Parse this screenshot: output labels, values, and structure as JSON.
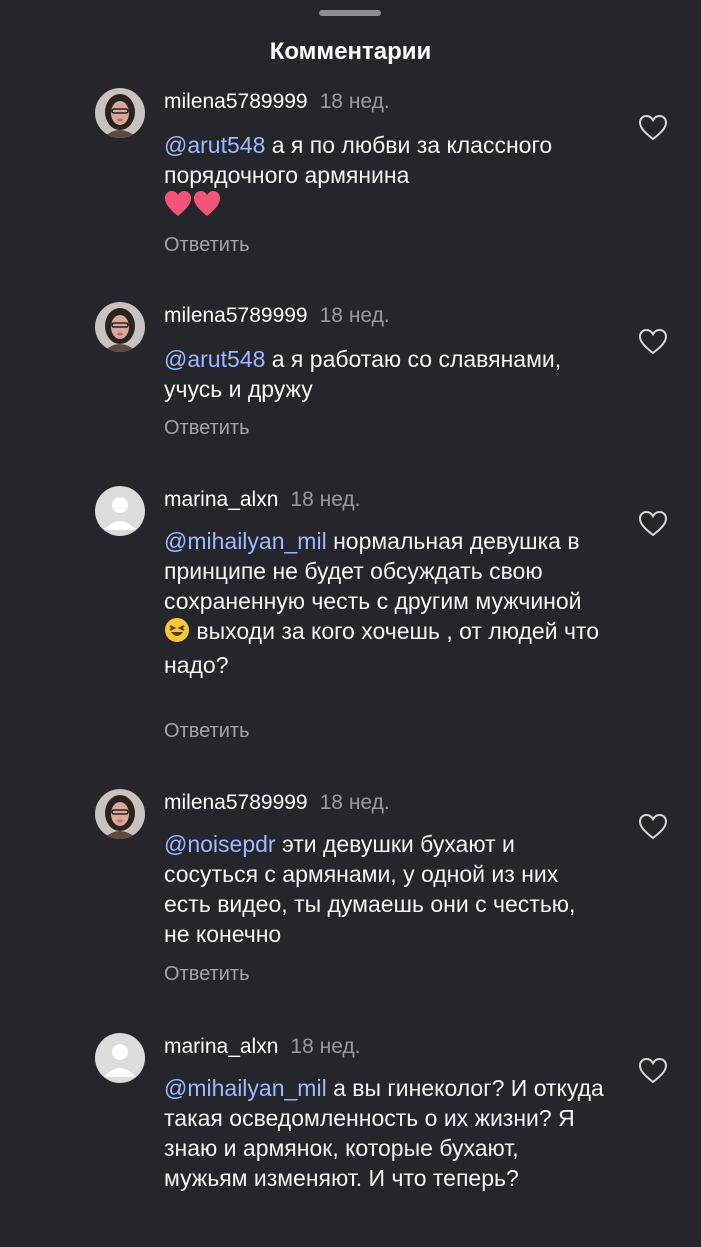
{
  "header": {
    "title": "Комментарии"
  },
  "comments": [
    {
      "username": "milena5789999",
      "time": "18 нед.",
      "mention": "@arut548",
      "text": " а я по любви за классного порядочного армянина",
      "reply_label": "Ответить",
      "avatar": "photo-avatar",
      "emoji": "two-pink-hearts"
    },
    {
      "username": "milena5789999",
      "time": "18 нед.",
      "mention": "@arut548",
      "text": " а я работаю со славянами, учусь и дружу",
      "reply_label": "Ответить",
      "avatar": "photo-avatar"
    },
    {
      "username": "marina_alxn",
      "time": "18 нед.",
      "mention": "@mihailyan_mil",
      "text": " нормальная девушка в принципе не будет обсуждать свою сохраненную честь с другим мужчиной",
      "text2": " выходи за кого хочешь , от людей что надо?",
      "reply_label": "Ответить",
      "avatar": "default-avatar",
      "emoji": "laughing-face"
    },
    {
      "username": "milena5789999",
      "time": "18 нед.",
      "mention": "@noisepdr",
      "text": " эти девушки бухают и сосуться с армянами, у одной из них есть видео, ты думаешь они с честью, не конечно",
      "reply_label": "Ответить",
      "avatar": "photo-avatar"
    },
    {
      "username": "marina_alxn",
      "time": "18 нед.",
      "mention": "@mihailyan_mil",
      "text": " а вы гинеколог? И откуда такая осведомленность о их жизни? Я знаю и армянок, которые бухают, мужьям изменяют. И что теперь?",
      "avatar": "default-avatar"
    }
  ],
  "icons": {
    "like": "heart-outline-icon"
  },
  "colors": {
    "background": "#25262b",
    "mention": "#9fb8ff",
    "muted": "#9a9ba0"
  }
}
